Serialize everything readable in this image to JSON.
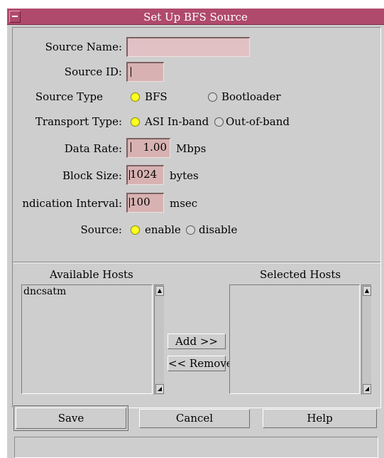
{
  "window": {
    "title": "Set Up BFS Source"
  },
  "form": {
    "source_name": {
      "label": "Source Name:",
      "value": ""
    },
    "source_id": {
      "label": "Source ID:",
      "value": ""
    },
    "source_type": {
      "label": "Source Type",
      "options": [
        {
          "label": "BFS",
          "selected": true
        },
        {
          "label": "Bootloader",
          "selected": false
        }
      ]
    },
    "transport_type": {
      "label": "Transport Type:",
      "options": [
        {
          "label": "ASI In-band",
          "selected": true
        },
        {
          "label": "Out-of-band",
          "selected": false
        }
      ]
    },
    "data_rate": {
      "label": "Data Rate:",
      "value": "1.00",
      "unit": "Mbps"
    },
    "block_size": {
      "label": "Block Size:",
      "value": "1024",
      "unit": "bytes"
    },
    "indication_interval": {
      "label": "ndication Interval:",
      "value": "100",
      "unit": "msec"
    },
    "source": {
      "label": "Source:",
      "options": [
        {
          "label": "enable",
          "selected": true
        },
        {
          "label": "disable",
          "selected": false
        }
      ]
    }
  },
  "hosts": {
    "available_label": "Available Hosts",
    "selected_label": "Selected Hosts",
    "available": [
      "dncsatm"
    ],
    "selected": [],
    "add_label": "Add >>",
    "remove_label": "<< Remove"
  },
  "buttons": {
    "save": "Save",
    "cancel": "Cancel",
    "help": "Help"
  },
  "colors": {
    "titlebar": "#b04a6c",
    "field": "#d8b2b2",
    "radio_on": "#ffff22",
    "background": "#cecece"
  }
}
